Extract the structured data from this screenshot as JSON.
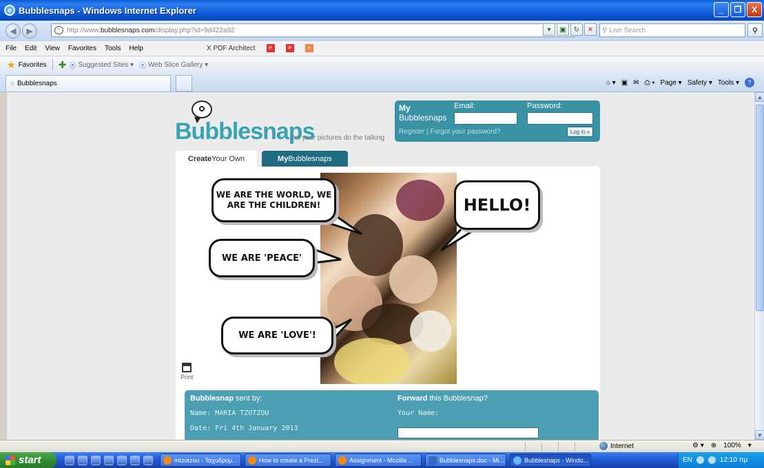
{
  "window": {
    "title": "Bubblesnaps - Windows Internet Explorer",
    "controls": [
      "_",
      "❐",
      "X"
    ]
  },
  "address_bar": {
    "prefix": "http://www.",
    "domain": "bubblesnaps.com",
    "path": "/display.php?id=9d422a92",
    "search_placeholder": "Live Search"
  },
  "menu": {
    "items": [
      "File",
      "Edit",
      "View",
      "Favorites",
      "Tools",
      "Help"
    ],
    "pdf_architect": "X  PDF Architect"
  },
  "favorites_bar": {
    "favorites": "Favorites",
    "suggested": "Suggested Sites ▾",
    "webslice": "Web Slice Gallery ▾"
  },
  "tabs": {
    "active_tab": "Bubblesnaps",
    "commands": [
      "Page ▾",
      "Safety ▾",
      "Tools ▾"
    ]
  },
  "site": {
    "logo": "Bubblesnaps",
    "tagline": "Let your pictures do the talking",
    "login": {
      "heading_line1": "My",
      "heading_line2": "Bubblesnaps",
      "email_label": "Email:",
      "password_label": "Password:",
      "links": "Register | Forgot your password?",
      "login_button": "Log in »"
    },
    "tab_create_strong": "Create",
    "tab_create_rest": " Your Own",
    "tab_mine_strong": "My",
    "tab_mine_rest": " Bubblesnaps",
    "bubbles": {
      "b1_line1": "WE ARE THE WORLD, WE",
      "b1_line2": "ARE THE CHILDREN!",
      "b2": "HELLO!",
      "b3": "WE ARE 'PEACE'",
      "b4": "WE ARE 'LOVE'!"
    },
    "print_label": "Print",
    "sent_by": {
      "heading_strong": "Bubblesnap",
      "heading_rest": " sent by:",
      "name": "Name: MARIA TZOTZOU",
      "date": "Date: Fri 4th January 2013"
    },
    "forward": {
      "heading_strong": "Forward",
      "heading_rest": " this Bubblesnap?",
      "your_name_label": "Your Name:"
    }
  },
  "statusbar": {
    "zone": "Internet",
    "zoom": "100%"
  },
  "taskbar": {
    "start": "start",
    "buttons": [
      "mtzotzou - Ταχυδρομ...",
      "How to create a Prezi...",
      "Assignment - Mozilla ...",
      "Bubblesnaps.doc - Mi...",
      "Bubblesnaps - Windo..."
    ],
    "tray_lang": "EN",
    "clock": "12:10 πμ"
  }
}
